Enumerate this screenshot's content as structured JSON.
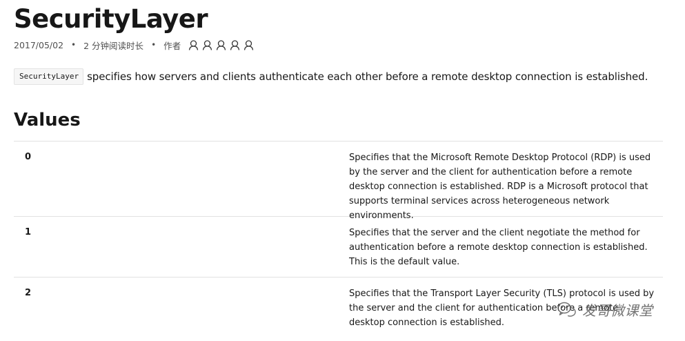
{
  "page": {
    "title": "SecurityLayer"
  },
  "meta": {
    "date": "2017/05/02",
    "bullet": "•",
    "read_time": "2 分钟阅读时长",
    "author_label": "作者",
    "contributors": [
      "contributor",
      "contributor",
      "contributor",
      "contributor",
      "contributor"
    ]
  },
  "intro": {
    "code": "SecurityLayer",
    "text": "specifies how servers and clients authenticate each other before a remote desktop connection is established."
  },
  "values_section": {
    "heading": "Values",
    "rows": [
      {
        "value": "0",
        "description": "Specifies that the Microsoft Remote Desktop Protocol (RDP) is used by the server and the client for authentication before a remote desktop connection is established. RDP is a Microsoft protocol that supports terminal services across heterogeneous network environments."
      },
      {
        "value": "1",
        "description": "Specifies that the server and the client negotiate the method for authentication before a remote desktop connection is established. This is the default value."
      },
      {
        "value": "2",
        "description": "Specifies that the Transport Layer Security (TLS) protocol is used by the server and the client for authentication before a remote desktop connection is established."
      }
    ]
  },
  "watermark": {
    "text": "发哥微课堂",
    "icon": "wechat-icon"
  }
}
